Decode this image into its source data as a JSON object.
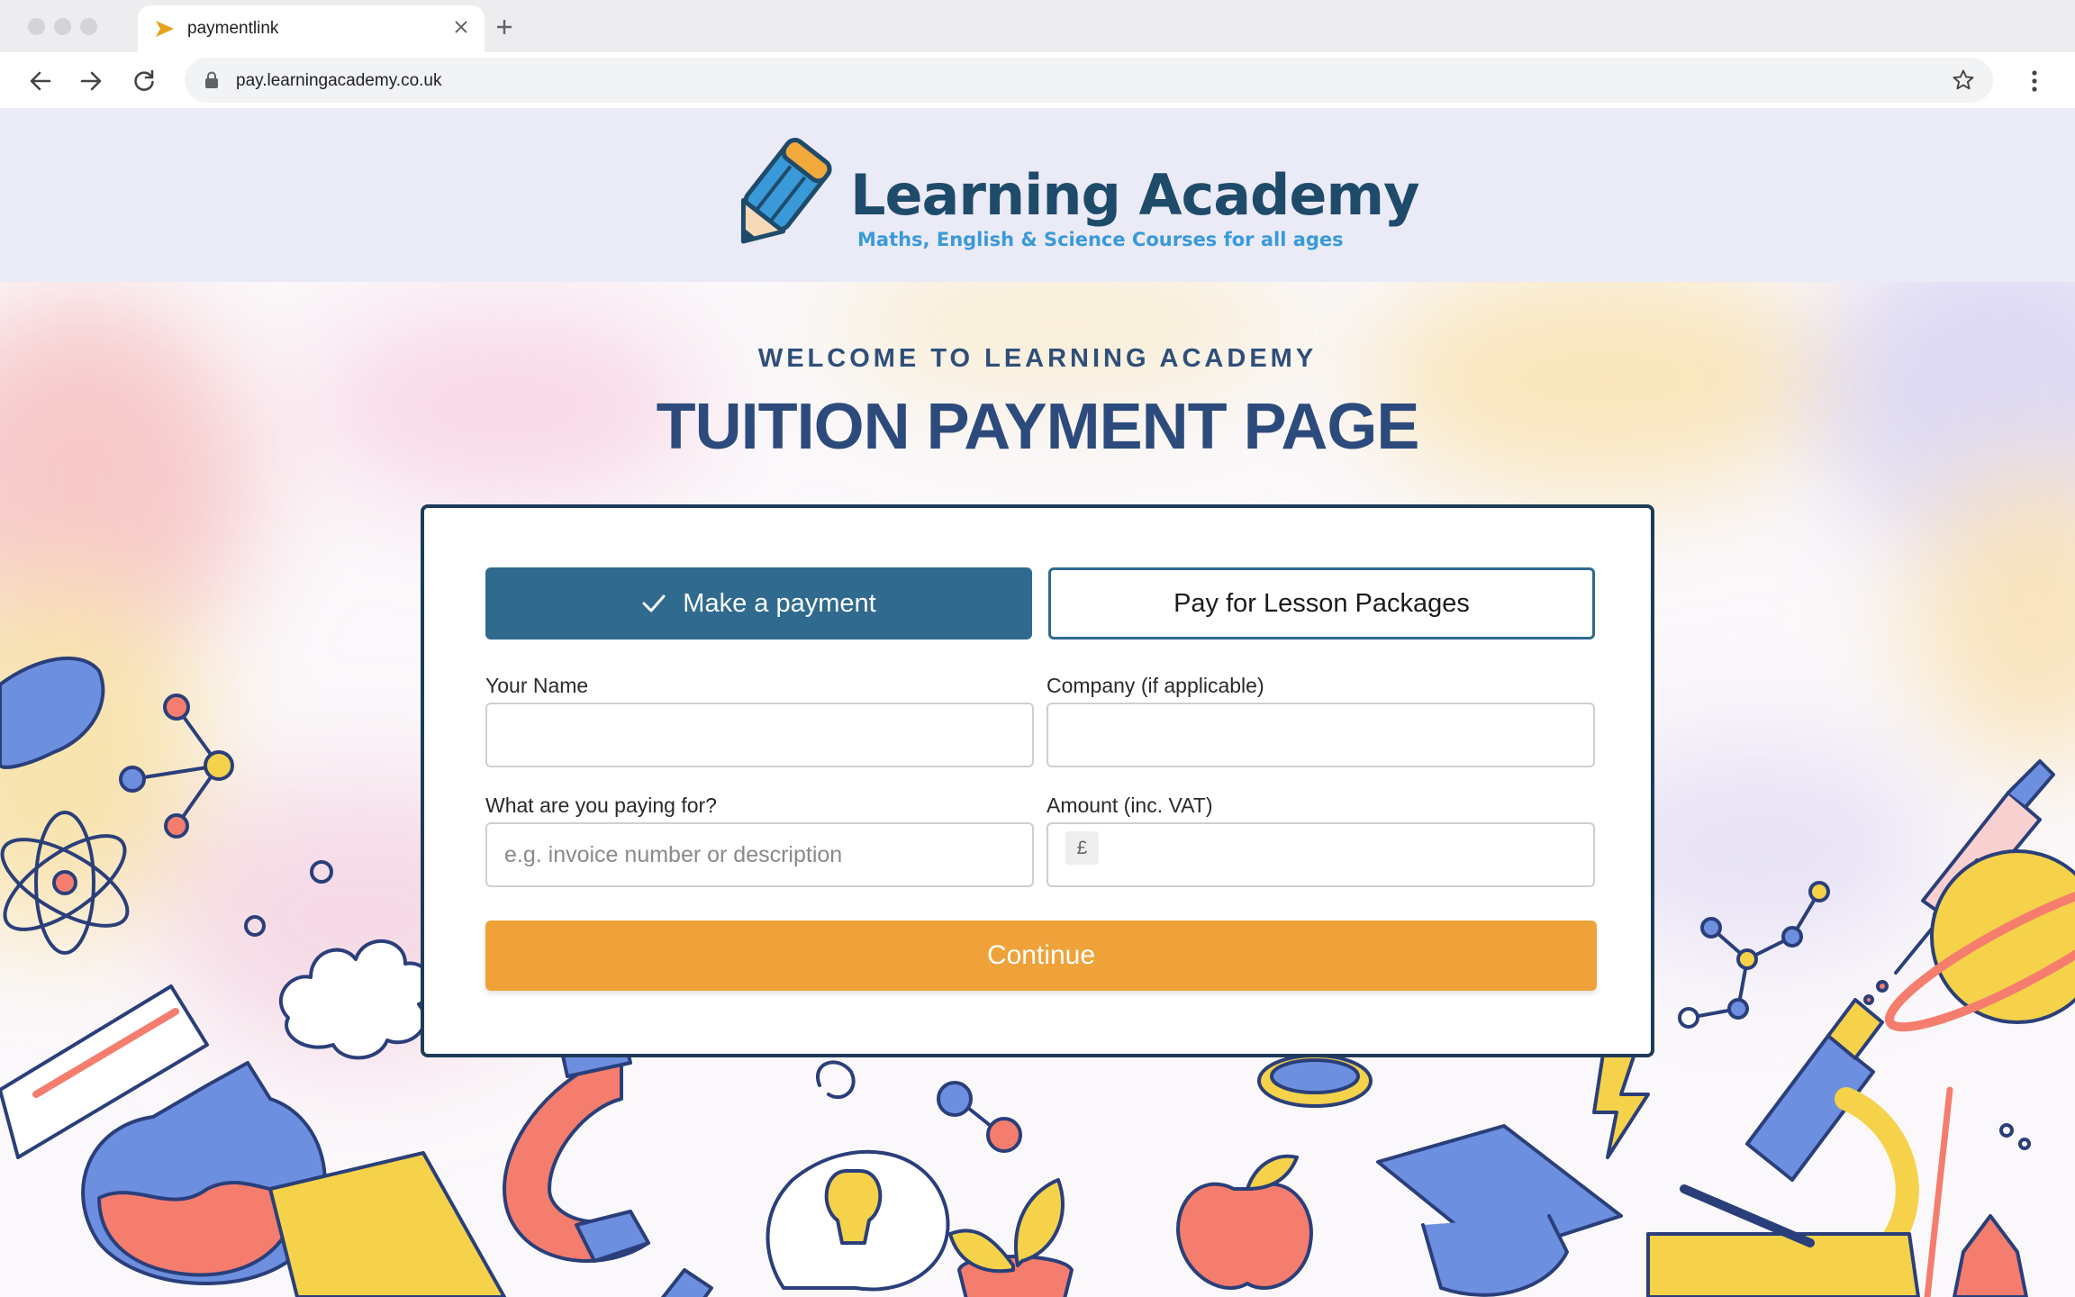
{
  "browser": {
    "tab_title": "paymentlink",
    "url": "pay.learningacademy.co.uk"
  },
  "header": {
    "logo_name": "Learning Academy",
    "logo_tagline": "Maths, English & Science Courses for all ages"
  },
  "hero": {
    "welcome": "WELCOME TO LEARNING ACADEMY",
    "title": "TUITION PAYMENT PAGE"
  },
  "form": {
    "tabs": [
      {
        "label": "Make a payment",
        "active": true
      },
      {
        "label": "Pay for Lesson Packages",
        "active": false
      }
    ],
    "name_label": "Your Name",
    "name_value": "",
    "company_label": "Company (if applicable)",
    "company_value": "",
    "paying_for_label": "What are you paying for?",
    "paying_for_placeholder": "e.g. invoice number or description",
    "amount_label": "Amount (inc. VAT)",
    "amount_value": "",
    "currency_symbol": "£",
    "continue_label": "Continue"
  },
  "colors": {
    "brand_blue": "#306a8e",
    "brand_navy": "#1c3c58",
    "accent_orange": "#efa23a",
    "tagline_blue": "#3a9ad9"
  },
  "icons": [
    "back-arrow-icon",
    "forward-arrow-icon",
    "reload-icon",
    "lock-icon",
    "star-icon",
    "menu-dots-icon",
    "close-icon",
    "plus-icon",
    "checkmark-icon",
    "pencil-logo-icon"
  ]
}
